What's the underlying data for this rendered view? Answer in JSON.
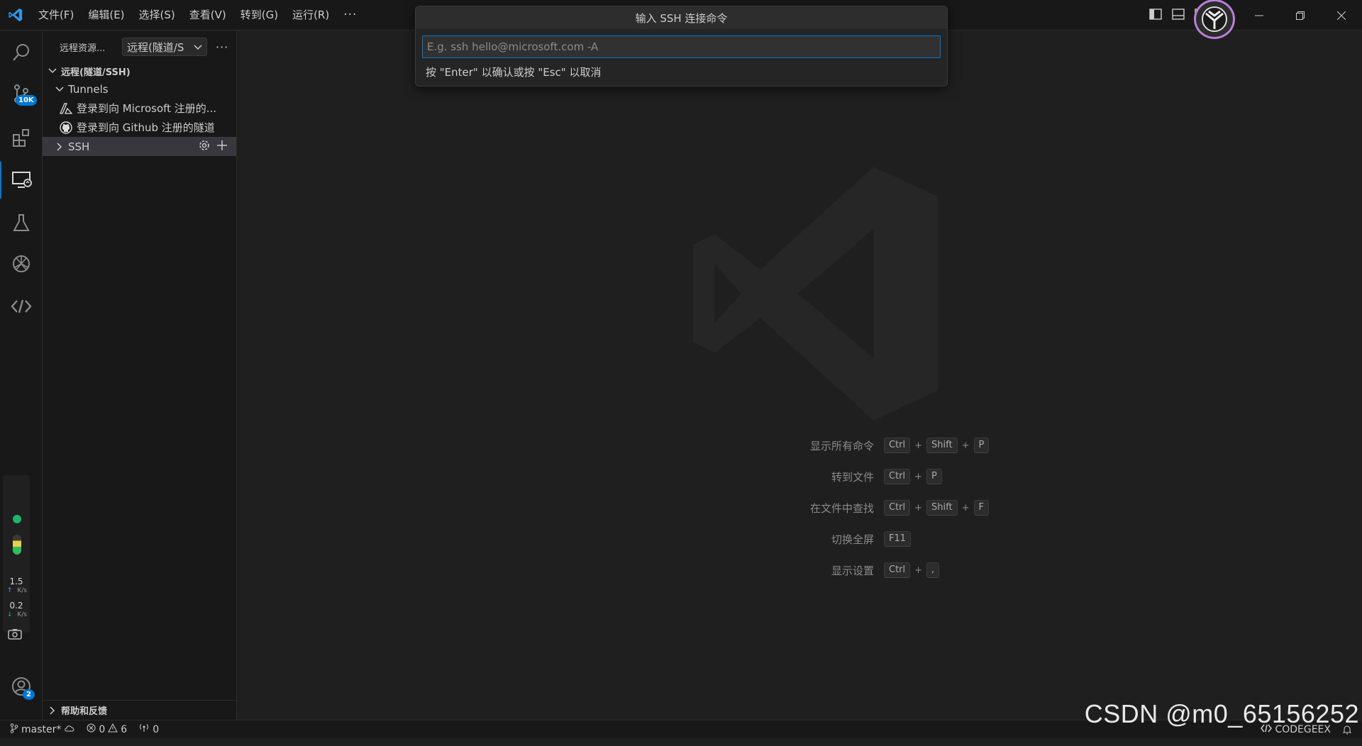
{
  "menu": [
    "文件(F)",
    "编辑(E)",
    "选择(S)",
    "查看(V)",
    "转到(G)",
    "运行(R)"
  ],
  "menu_more": "···",
  "activity": {
    "source_control_badge": "10K",
    "accounts_badge": "2",
    "net_up_value": "1.5",
    "net_up_unit": "K/s",
    "net_down_value": "0.2",
    "net_down_unit": "K/s"
  },
  "sidebar": {
    "title": "远程资源...",
    "view_select": "远程(隧道/S",
    "section": "远程(隧道/SSH)",
    "tunnels_label": "Tunnels",
    "items": [
      {
        "label": "登录到向 Microsoft 注册的..."
      },
      {
        "label": "登录到向 Github 注册的隧道"
      }
    ],
    "ssh_label": "SSH",
    "footer": "帮助和反馈"
  },
  "quick_input": {
    "title": "输入 SSH 连接命令",
    "placeholder": "E.g. ssh hello@microsoft.com -A",
    "value": "",
    "hint": "按 \"Enter\" 以确认或按 \"Esc\" 以取消"
  },
  "shortcuts": [
    {
      "label": "显示所有命令",
      "keys": [
        "Ctrl",
        "Shift",
        "P"
      ]
    },
    {
      "label": "转到文件",
      "keys": [
        "Ctrl",
        "P"
      ]
    },
    {
      "label": "在文件中查找",
      "keys": [
        "Ctrl",
        "Shift",
        "F"
      ]
    },
    {
      "label": "切换全屏",
      "keys": [
        "F11"
      ]
    },
    {
      "label": "显示设置",
      "keys": [
        "Ctrl",
        ","
      ]
    }
  ],
  "status": {
    "branch": "master*",
    "errors": "0",
    "warnings": "6",
    "ports": "0",
    "codegeex": "CODEGEEX"
  },
  "watermark": "CSDN @m0_65156252",
  "colors": {
    "accent": "#0078d4",
    "background": "#1f1f1f",
    "sidebar": "#181818"
  }
}
